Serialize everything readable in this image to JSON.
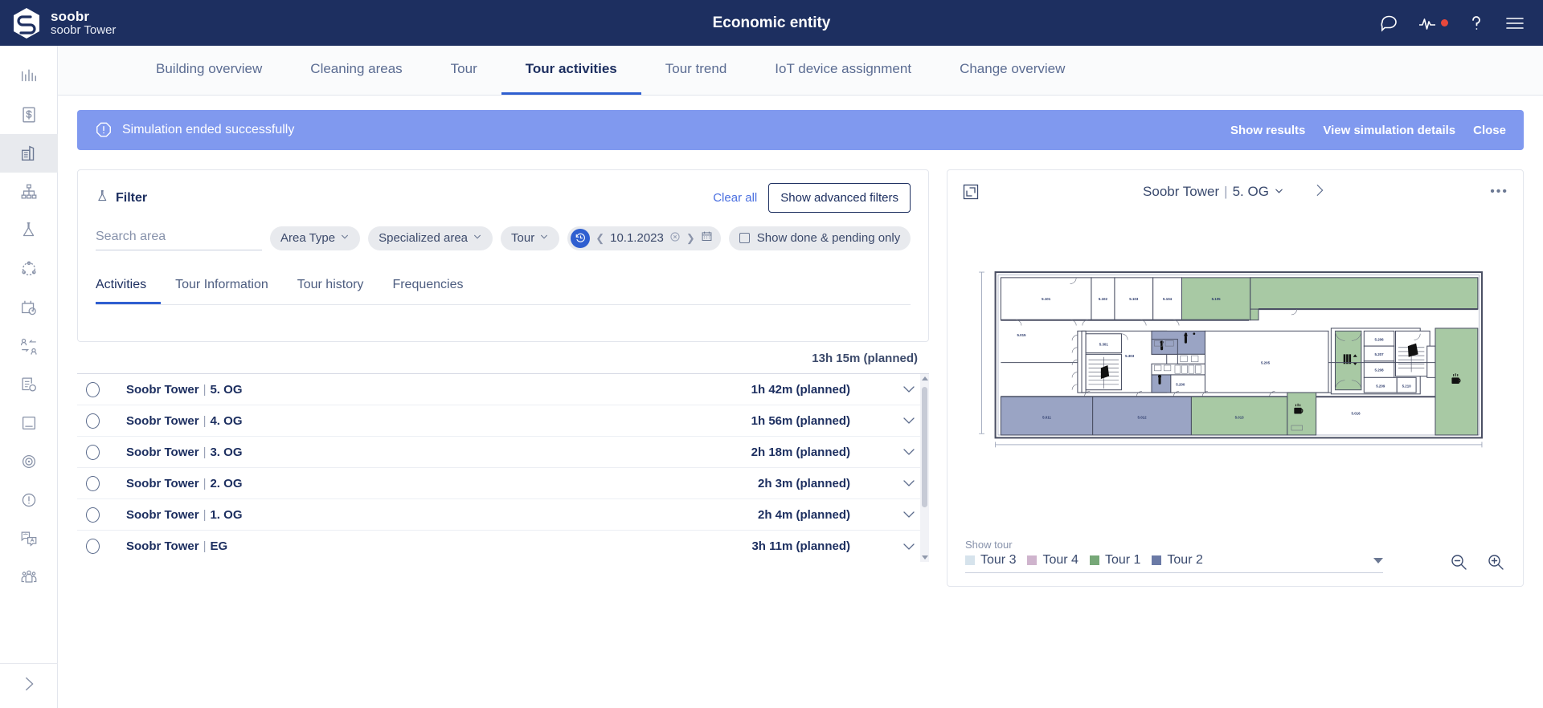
{
  "topbar": {
    "brand_name": "soobr",
    "brand_sub": "soobr Tower",
    "title": "Economic entity",
    "icons": [
      "chat-icon",
      "pulse-icon",
      "help-icon",
      "menu-icon"
    ],
    "background": "#1d2f60",
    "notification_dot_color": "#e8483c"
  },
  "rail": {
    "items": [
      {
        "name": "bar-chart-icon",
        "active": false
      },
      {
        "name": "cost-document-icon",
        "active": false
      },
      {
        "name": "building-icon",
        "active": true
      },
      {
        "name": "org-structure-icon",
        "active": false
      },
      {
        "name": "funnel-icon",
        "active": false
      },
      {
        "name": "network-icon",
        "active": false
      },
      {
        "name": "calendar-clock-icon",
        "active": false
      },
      {
        "name": "user-swap-icon",
        "active": false
      },
      {
        "name": "document-search-icon",
        "active": false
      },
      {
        "name": "card-icon",
        "active": false
      },
      {
        "name": "target-icon",
        "active": false
      },
      {
        "name": "alert-circle-icon",
        "active": false
      },
      {
        "name": "translate-icon",
        "active": false
      },
      {
        "name": "group-users-icon",
        "active": false
      }
    ],
    "expand_label": "chevron-right-icon"
  },
  "tabs": [
    {
      "label": "Building overview",
      "active": false
    },
    {
      "label": "Cleaning areas",
      "active": false
    },
    {
      "label": "Tour",
      "active": false
    },
    {
      "label": "Tour activities",
      "active": true
    },
    {
      "label": "Tour trend",
      "active": false
    },
    {
      "label": "IoT device assignment",
      "active": false
    },
    {
      "label": "Change overview",
      "active": false
    }
  ],
  "banner": {
    "message": "Simulation ended successfully",
    "icon": "alert-octagon-icon",
    "background": "#8099ef",
    "actions": [
      "Show results",
      "View simulation details",
      "Close"
    ]
  },
  "filter": {
    "title": "Filter",
    "icon": "funnel-icon",
    "clear_all": "Clear all",
    "advanced_button": "Show advanced filters",
    "search_placeholder": "Search area",
    "search_value": "",
    "chips": [
      {
        "label": "Area Type",
        "type": "dropdown"
      },
      {
        "label": "Specialized area",
        "type": "dropdown"
      },
      {
        "label": "Tour",
        "type": "dropdown"
      }
    ],
    "date_chip": {
      "value": "10.1.2023",
      "icon": "history-icon"
    },
    "checkbox_chip": {
      "label": "Show done & pending only",
      "checked": false
    }
  },
  "inner_tabs": [
    {
      "label": "Activities",
      "active": true
    },
    {
      "label": "Tour Information",
      "active": false
    },
    {
      "label": "Tour history",
      "active": false
    },
    {
      "label": "Frequencies",
      "active": false
    }
  ],
  "activities": {
    "total": "13h 15m (planned)",
    "rows": [
      {
        "building": "Soobr Tower",
        "floor": "5. OG",
        "duration": "1h 42m (planned)"
      },
      {
        "building": "Soobr Tower",
        "floor": "4. OG",
        "duration": "1h 56m (planned)"
      },
      {
        "building": "Soobr Tower",
        "floor": "3. OG",
        "duration": "2h 18m (planned)"
      },
      {
        "building": "Soobr Tower",
        "floor": "2. OG",
        "duration": "2h 3m (planned)"
      },
      {
        "building": "Soobr Tower",
        "floor": "1. OG",
        "duration": "2h 4m (planned)"
      },
      {
        "building": "Soobr Tower",
        "floor": "EG",
        "duration": "3h 11m (planned)"
      }
    ]
  },
  "floorplan": {
    "title_building": "Soobr Tower",
    "title_floor": "5. OG",
    "expand_icon": "expand-icon",
    "next_icon": "chevron-right-icon",
    "more_icon": "more-options-icon",
    "rooms": [
      {
        "id": "5.101"
      },
      {
        "id": "5.102"
      },
      {
        "id": "5.103"
      },
      {
        "id": "5.104"
      },
      {
        "id": "5.105"
      },
      {
        "id": "5.015"
      },
      {
        "id": "5.301"
      },
      {
        "id": "5.303"
      },
      {
        "id": "5.200"
      },
      {
        "id": "5.205"
      },
      {
        "id": "5.206"
      },
      {
        "id": "5.207"
      },
      {
        "id": "5.208"
      },
      {
        "id": "5.209"
      },
      {
        "id": "5.210"
      },
      {
        "id": "5.016"
      },
      {
        "id": "5.011"
      },
      {
        "id": "5.012"
      },
      {
        "id": "5.013"
      }
    ],
    "show_tour_label": "Show tour",
    "tours": [
      {
        "label": "Tour 3",
        "color": "#d6e3ec"
      },
      {
        "label": "Tour 4",
        "color": "#cfb4cd"
      },
      {
        "label": "Tour 1",
        "color": "#77a878"
      },
      {
        "label": "Tour 2",
        "color": "#6b7aa6"
      }
    ],
    "zoom_out": "zoom-out-icon",
    "zoom_in": "zoom-in-icon"
  }
}
